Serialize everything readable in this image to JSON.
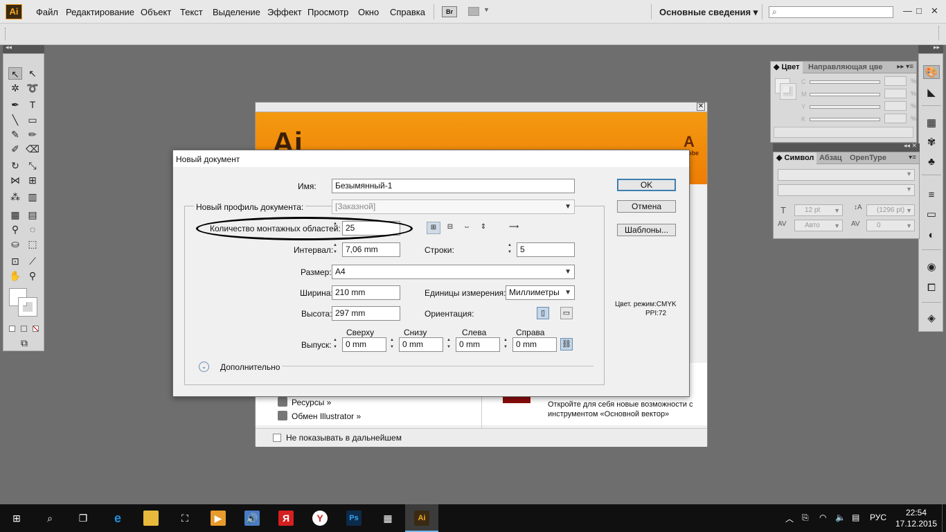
{
  "menubar": {
    "logo": "Ai",
    "items": [
      "Файл",
      "Редактирование",
      "Объект",
      "Текст",
      "Выделение",
      "Эффект",
      "Просмотр",
      "Окно",
      "Справка"
    ],
    "bridge": "Br",
    "workspace": "Основные сведения ▾",
    "window_controls": [
      "—",
      "□",
      "✕"
    ]
  },
  "panels": {
    "color": {
      "tabs": [
        "◆ Цвет",
        "Направляющая цве"
      ],
      "rows": [
        "C",
        "M",
        "Y",
        "K"
      ],
      "pct": "%"
    },
    "character": {
      "tabs": [
        "◆ Символ",
        "Абзац",
        "OpenType"
      ],
      "size": "12 pt",
      "leading": "(1296 pt)",
      "kerning": "Авто",
      "tracking": "0"
    }
  },
  "welcome": {
    "logo": "Ai",
    "adobe": "Adobe",
    "links": [
      "Ресурсы »",
      "Обмен Illustrator »"
    ],
    "promo": "Откройте для себя новые возможности с инструментом «Основной вектор»",
    "dont_show": "Не показывать в дальнейшем"
  },
  "dialog": {
    "title": "Новый документ",
    "name_label": "Имя:",
    "name_value": "Безымянный-1",
    "profile_label": "Новый профиль документа:",
    "profile_value": "[Заказной]",
    "artboards_label": "Количество монтажных областей:",
    "artboards_value": "25",
    "spacing_label": "Интервал:",
    "spacing_value": "7,06 mm",
    "rows_label": "Строки:",
    "rows_value": "5",
    "size_label": "Размер:",
    "size_value": "A4",
    "width_label": "Ширина:",
    "width_value": "210 mm",
    "units_label": "Единицы измерения:",
    "units_value": "Миллиметры",
    "height_label": "Высота:",
    "height_value": "297 mm",
    "orientation_label": "Ориентация:",
    "bleed_label": "Выпуск:",
    "bleed_headers": [
      "Сверху",
      "Снизу",
      "Слева",
      "Справа"
    ],
    "bleed_values": [
      "0 mm",
      "0 mm",
      "0 mm",
      "0 mm"
    ],
    "advanced_label": "Дополнительно",
    "ok": "OK",
    "cancel": "Отмена",
    "templates": "Шаблоны...",
    "color_mode": "Цвет. режим:CMYK",
    "ppi": "PPI:72"
  },
  "taskbar": {
    "language": "РУС",
    "time": "22:54",
    "date": "17.12.2015"
  },
  "colors": {
    "accent": "#f7a823",
    "dialog_bg": "#f0f0f0",
    "taskbar": "#101010"
  }
}
